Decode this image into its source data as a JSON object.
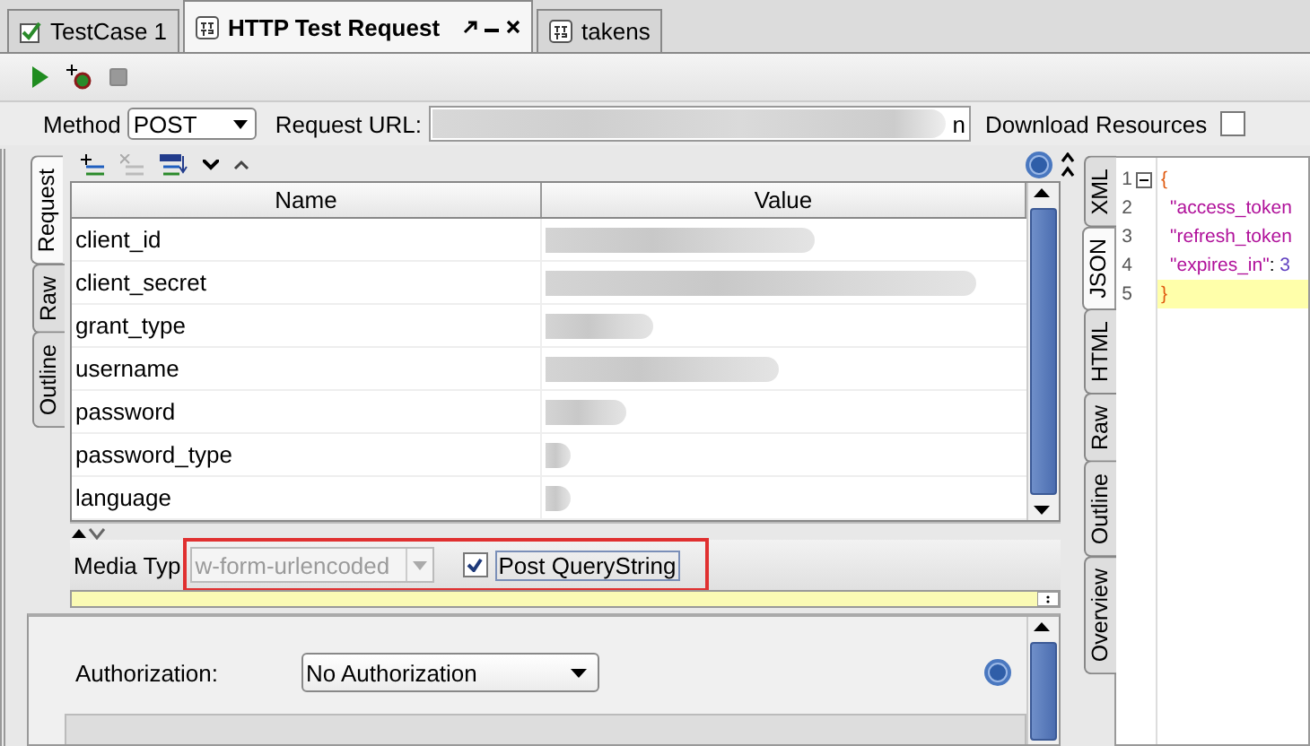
{
  "tabs": [
    {
      "label": "TestCase 1",
      "kind": "testcase",
      "selected": false
    },
    {
      "label": "HTTP Test Request",
      "kind": "http",
      "selected": true
    },
    {
      "label": "takens",
      "kind": "http",
      "selected": false
    }
  ],
  "request": {
    "method_label": "Method",
    "method": "POST",
    "url_label": "Request URL:",
    "url_tail": "n",
    "download_label": "Download Resources",
    "download_checked": false
  },
  "request_tabs": [
    {
      "label": "Request",
      "selected": true
    },
    {
      "label": "Raw",
      "selected": false
    },
    {
      "label": "Outline",
      "selected": false
    }
  ],
  "params": {
    "columns": [
      "Name",
      "Value"
    ],
    "rows": [
      {
        "name": "client_id"
      },
      {
        "name": "client_secret"
      },
      {
        "name": "grant_type"
      },
      {
        "name": "username"
      },
      {
        "name": "password"
      },
      {
        "name": "password_type"
      },
      {
        "name": "language"
      }
    ]
  },
  "media_type": {
    "label": "Media Typ",
    "value": "w-form-urlencoded",
    "disabled": true
  },
  "post_querystring": {
    "label": "Post QueryString",
    "checked": true
  },
  "authorization": {
    "label": "Authorization:",
    "value": "No Authorization"
  },
  "response_tabs": [
    {
      "label": "XML",
      "selected": false
    },
    {
      "label": "JSON",
      "selected": true
    },
    {
      "label": "HTML",
      "selected": false
    },
    {
      "label": "Raw",
      "selected": false
    },
    {
      "label": "Outline",
      "selected": false
    },
    {
      "label": "Overview",
      "selected": false
    }
  ],
  "response_code": [
    {
      "number": "1",
      "current": false,
      "tokens": [
        {
          "text": "{",
          "kind": "brace"
        }
      ]
    },
    {
      "number": "2",
      "current": false,
      "tokens": [
        {
          "text": "\"access_token",
          "kind": "key"
        }
      ]
    },
    {
      "number": "3",
      "current": false,
      "tokens": [
        {
          "text": "\"refresh_token",
          "kind": "key"
        }
      ]
    },
    {
      "number": "4",
      "current": false,
      "tokens": [
        {
          "text": "\"expires_in\"",
          "kind": "key"
        },
        {
          "text": ": ",
          "kind": "punct"
        },
        {
          "text": "3",
          "kind": "number"
        }
      ]
    },
    {
      "number": "5",
      "current": true,
      "tokens": [
        {
          "text": "}",
          "kind": "brace"
        }
      ]
    }
  ]
}
